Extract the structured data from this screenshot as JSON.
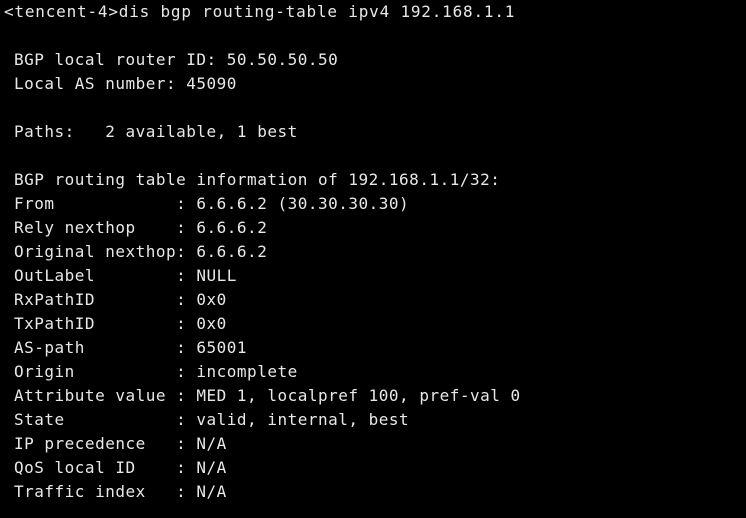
{
  "terminal": {
    "prompt_line": "<tencent-4>dis bgp routing-table ipv4 192.168.1.1",
    "router_id": "BGP local router ID: 50.50.50.50",
    "local_as": "Local AS number: 45090",
    "paths": "Paths:   2 available, 1 best",
    "table_info": "BGP routing table information of 192.168.1.1/32:",
    "attributes": [
      "From            : 6.6.6.2 (30.30.30.30)",
      "Rely nexthop    : 6.6.6.2",
      "Original nexthop: 6.6.6.2",
      "OutLabel        : NULL",
      "RxPathID        : 0x0",
      "TxPathID        : 0x0",
      "AS-path         : 65001",
      "Origin          : incomplete",
      "Attribute value : MED 1, localpref 100, pref-val 0",
      "State           : valid, internal, best",
      "IP precedence   : N/A",
      "QoS local ID    : N/A",
      "Traffic index   : N/A"
    ]
  },
  "colors": {
    "background": "#000000",
    "text": "#e8e8e8"
  }
}
